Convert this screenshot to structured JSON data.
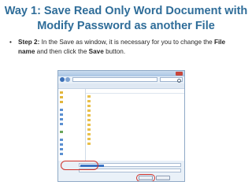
{
  "slide": {
    "title_line1": "Way 1: Save Read Only Word Document with",
    "title_line2": "Modify Password as another File",
    "bullet": "•",
    "step_label": "Step 2:",
    "text_a": " In the Save as window, it is necessary for you to change the ",
    "bold_file": "File",
    "bold_name": "name",
    "text_b": " and then click the ",
    "bold_save": "Save",
    "text_c": " button."
  },
  "save_as_window": {
    "highlight_color": "#d0322a"
  }
}
